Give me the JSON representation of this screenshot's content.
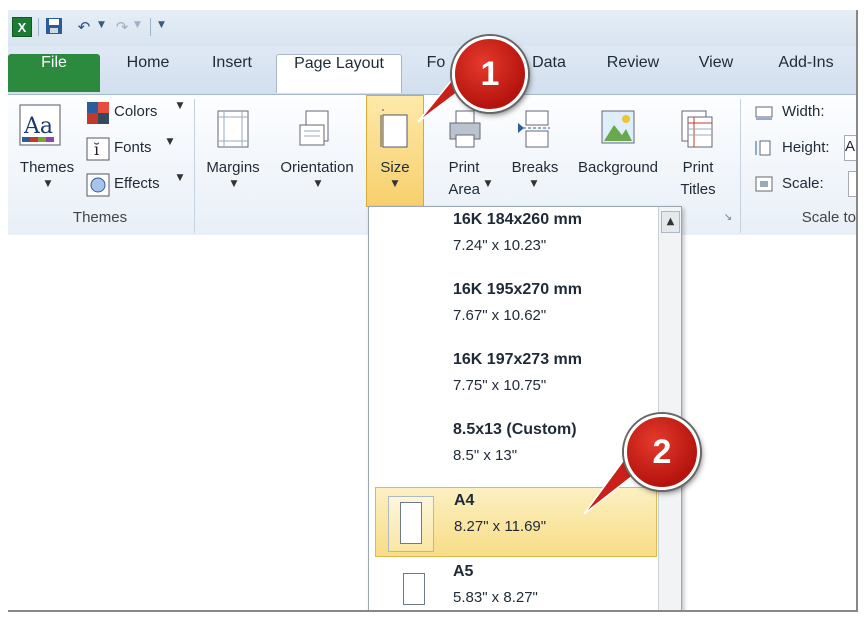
{
  "qat": {
    "excel_icon": "X",
    "icons": [
      "excel-icon",
      "save-icon",
      "undo-icon",
      "redo-icon",
      "customize-qat-icon"
    ]
  },
  "tabs": [
    {
      "label": "File"
    },
    {
      "label": "Home"
    },
    {
      "label": "Insert"
    },
    {
      "label": "Page Layout"
    },
    {
      "label": "Fo"
    },
    {
      "label": "Data"
    },
    {
      "label": "Review"
    },
    {
      "label": "View"
    },
    {
      "label": "Add-Ins"
    }
  ],
  "ribbon": {
    "themes": {
      "themes_label": "Themes",
      "colors_label": "Colors",
      "fonts_label": "Fonts",
      "effects_label": "Effects",
      "group_label": "Themes"
    },
    "page_setup": {
      "margins_label": "Margins",
      "orientation_label": "Orientation",
      "size_label": "Size",
      "print_area_label1": "Print",
      "print_area_label2": "Area",
      "breaks_label": "Breaks",
      "background_label": "Background",
      "print_titles_label1": "Print",
      "print_titles_label2": "Titles"
    },
    "scale": {
      "width_label": "Width:",
      "height_label": "Height:",
      "height_value": "A",
      "scale_label": "Scale:",
      "group_label": "Scale to"
    }
  },
  "size_dropdown": {
    "items": [
      {
        "name": "16K 184x260 mm",
        "dims": "7.24\" x 10.23\""
      },
      {
        "name": "16K 195x270 mm",
        "dims": "7.67\" x 10.62\""
      },
      {
        "name": "16K 197x273 mm",
        "dims": "7.75\" x 10.75\""
      },
      {
        "name": "8.5x13 (Custom)",
        "dims": "8.5\" x 13\""
      },
      {
        "name": "A4",
        "dims": "8.27\" x 11.69\"",
        "selected": true
      },
      {
        "name": "A5",
        "dims": "5.83\" x 8.27\""
      }
    ]
  },
  "callouts": {
    "one": "1",
    "two": "2"
  },
  "colors": {
    "file_tab": "#2b8a3e",
    "highlight": "#f8dd86",
    "callout": "#c9201a"
  }
}
